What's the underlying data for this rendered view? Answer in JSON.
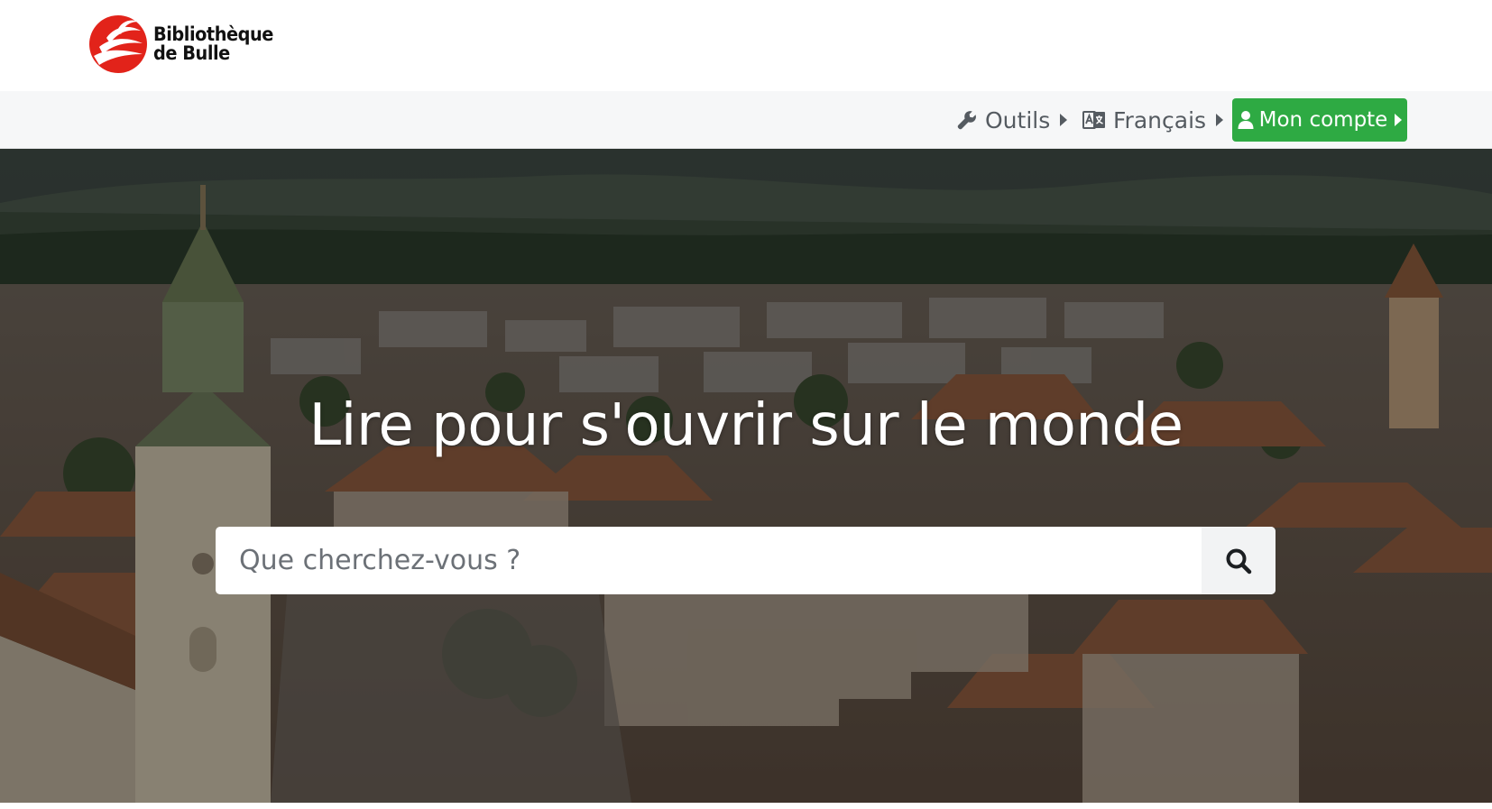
{
  "header": {
    "logo_line1": "Bibliothèque",
    "logo_line2": "de Bulle",
    "logo_icon": "red-swoosh-logo"
  },
  "nav": {
    "tools_label": "Outils",
    "tools_icon": "wrench-icon",
    "language_label": "Français",
    "language_icon": "translate-icon",
    "account_label": "Mon compte",
    "account_icon": "user-icon"
  },
  "hero": {
    "title": "Lire pour s'ouvrir sur le monde",
    "background": "aerial-town-photo"
  },
  "search": {
    "placeholder": "Que cherchez-vous ?",
    "value": "",
    "button_icon": "search-icon"
  },
  "colors": {
    "accent": "#2eaa43",
    "logo_red": "#e2231a",
    "nav_background": "#f6f7f8"
  }
}
